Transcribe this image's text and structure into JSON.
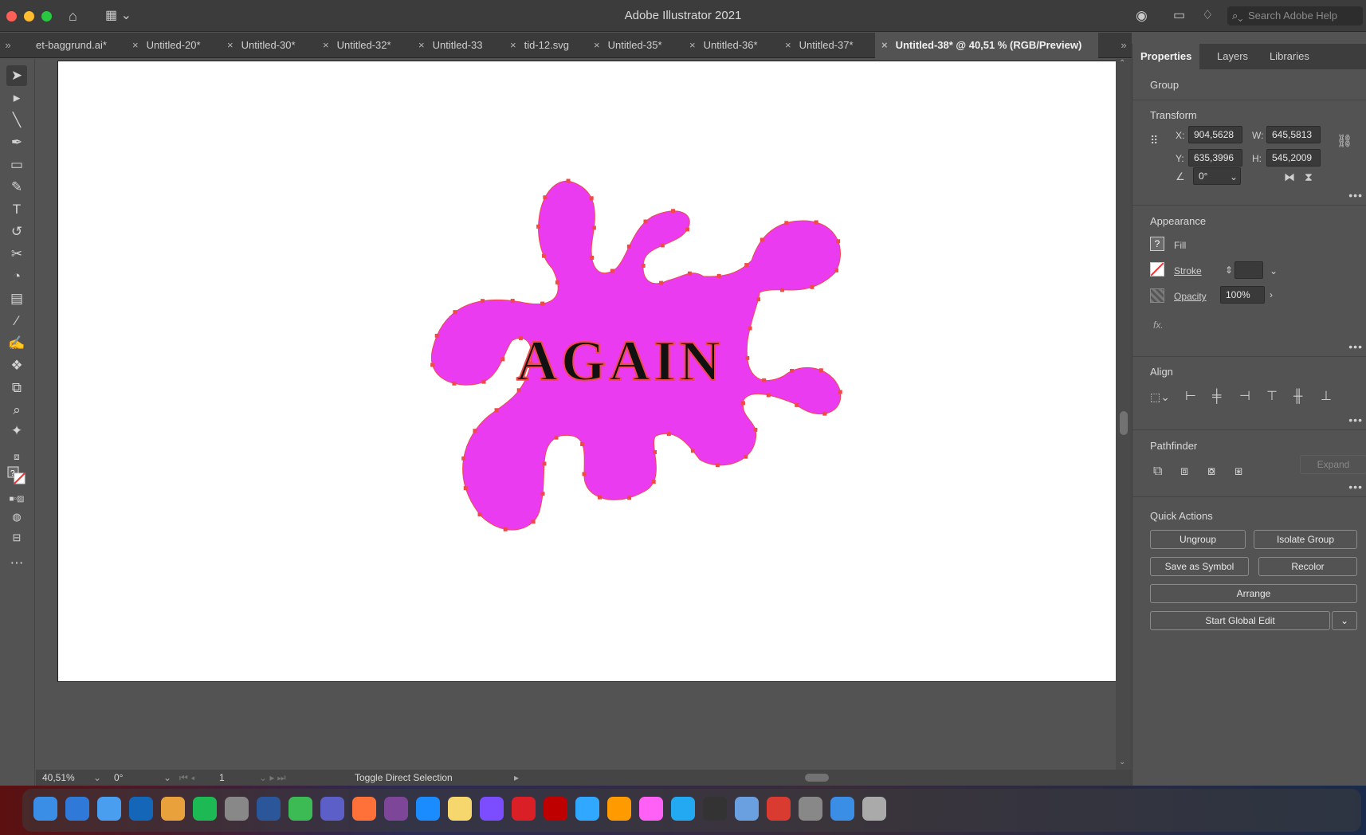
{
  "app": {
    "title": "Adobe Illustrator 2021",
    "search_placeholder": "Search Adobe Help"
  },
  "tabs": [
    {
      "label": "et-baggrund.ai*"
    },
    {
      "label": "Untitled-20*"
    },
    {
      "label": "Untitled-30*"
    },
    {
      "label": "Untitled-32*"
    },
    {
      "label": "Untitled-33"
    },
    {
      "label": "tid-12.svg"
    },
    {
      "label": "Untitled-35*"
    },
    {
      "label": "Untitled-36*"
    },
    {
      "label": "Untitled-37*"
    },
    {
      "label": "Untitled-38* @ 40,51 % (RGB/Preview)",
      "active": true
    }
  ],
  "tab_close_glyph": "×",
  "canvas": {
    "artwork_text": "AGAIN",
    "splash_color": "#ea3bf0",
    "anchor_color": "#ef4a4a"
  },
  "statusbar": {
    "zoom": "40,51%",
    "rotation": "0°",
    "artboard": "1",
    "tool_hint": "Toggle Direct Selection"
  },
  "panel": {
    "tabs": [
      "Properties",
      "Layers",
      "Libraries"
    ],
    "selection_type": "Group",
    "transform": {
      "title": "Transform",
      "x_label": "X:",
      "x": "904,5628",
      "y_label": "Y:",
      "y": "635,3996",
      "w_label": "W:",
      "w": "645,5813",
      "h_label": "H:",
      "h": "545,2009",
      "angle": "0°"
    },
    "appearance": {
      "title": "Appearance",
      "fill_label": "Fill",
      "stroke_label": "Stroke",
      "opacity_label": "Opacity",
      "opacity": "100%",
      "fx": "fx."
    },
    "align": {
      "title": "Align"
    },
    "pathfinder": {
      "title": "Pathfinder",
      "expand": "Expand"
    },
    "quick_actions": {
      "title": "Quick Actions",
      "ungroup": "Ungroup",
      "isolate": "Isolate Group",
      "save_symbol": "Save as Symbol",
      "recolor": "Recolor",
      "arrange": "Arrange",
      "global_edit": "Start Global Edit"
    }
  },
  "dock_icons": [
    "finder",
    "safari",
    "mail",
    "outlook",
    "photos",
    "spotify",
    "system-preferences",
    "word",
    "sketchbook",
    "teams",
    "firefox",
    "tor",
    "app-store",
    "notes",
    "messenger",
    "creative-cloud",
    "filezilla",
    "photoshop",
    "illustrator",
    "xd",
    "vscode",
    "flash",
    "preview",
    "acrobat",
    "image-capture",
    "downloads",
    "trash"
  ]
}
